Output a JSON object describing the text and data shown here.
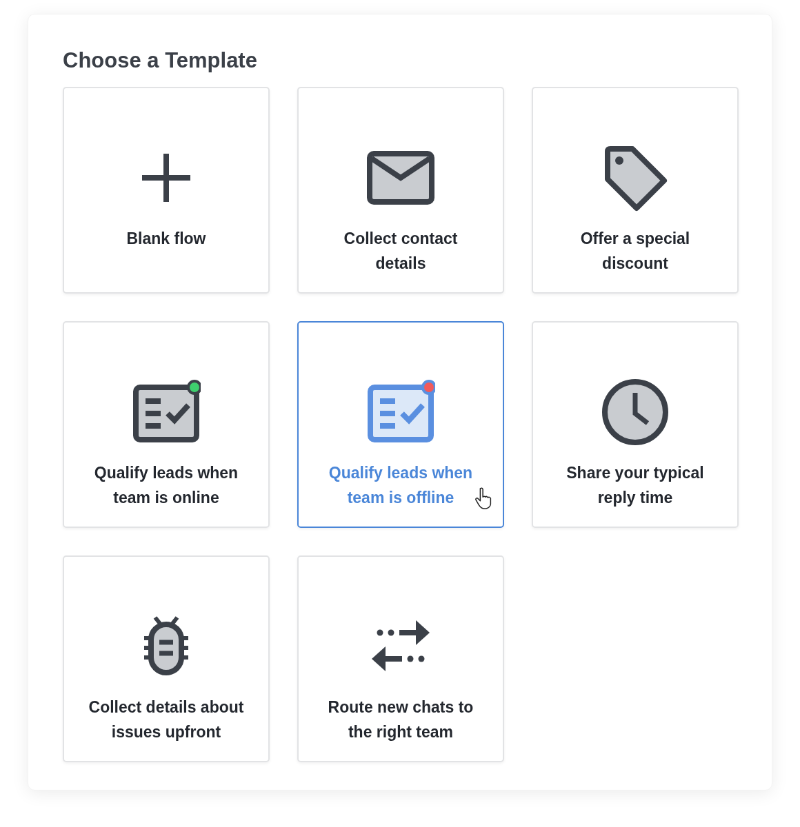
{
  "title": "Choose a Template",
  "templates": [
    {
      "kind": "plus",
      "label_lines": [
        "Blank flow"
      ],
      "selected": false
    },
    {
      "kind": "envelope",
      "label_lines": [
        "Collect contact",
        "details"
      ],
      "selected": false
    },
    {
      "kind": "tag",
      "label_lines": [
        "Offer a special",
        "discount"
      ],
      "selected": false
    },
    {
      "kind": "checklist",
      "label_lines": [
        "Qualify leads when",
        "team is online"
      ],
      "selected": false,
      "color": "#3ecf6e"
    },
    {
      "kind": "checklist",
      "label_lines": [
        "Qualify leads when",
        "team is offline"
      ],
      "selected": true,
      "color": "#f25a5a"
    },
    {
      "kind": "clock",
      "label_lines": [
        "Share your typical",
        "reply time"
      ],
      "selected": false
    },
    {
      "kind": "bug",
      "label_lines": [
        "Collect details about",
        "issues upfront"
      ],
      "selected": false
    },
    {
      "kind": "arrows",
      "label_lines": [
        "Route new chats to",
        "the right team"
      ],
      "selected": false
    }
  ]
}
